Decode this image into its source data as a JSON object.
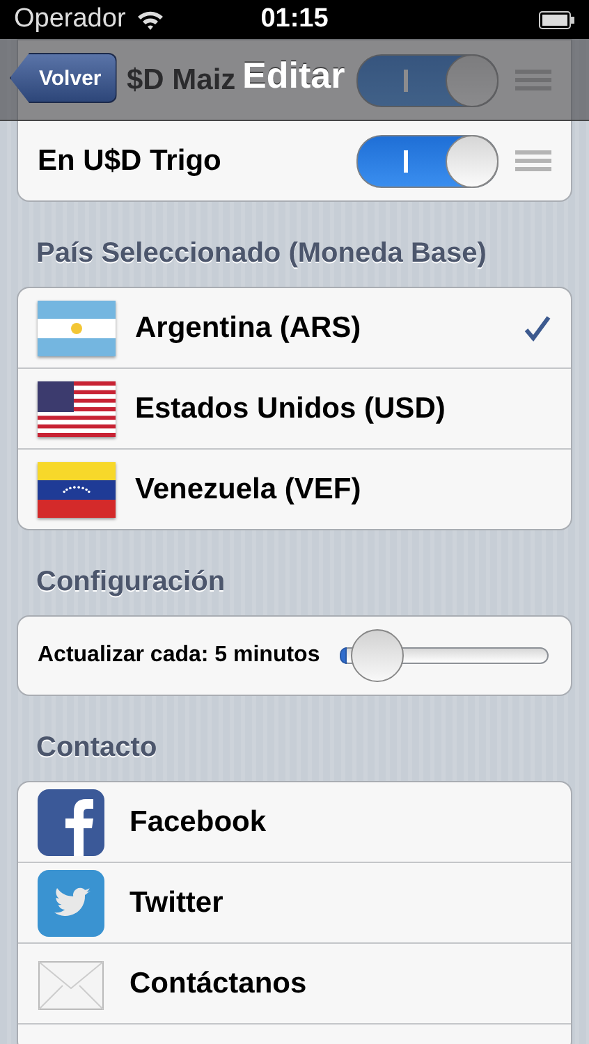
{
  "status_bar": {
    "carrier": "Operador",
    "time": "01:15"
  },
  "nav_bar": {
    "back_button": "Volver",
    "title": "Editar"
  },
  "toggles": [
    {
      "label": "$D Maiz",
      "on": true
    },
    {
      "label": "En U$D Trigo",
      "on": true
    }
  ],
  "country_section": {
    "header": "País Seleccionado (Moneda Base)",
    "items": [
      {
        "kind": "ar",
        "name": "Argentina (ARS)",
        "selected": true
      },
      {
        "kind": "us",
        "name": "Estados Unidos (USD)",
        "selected": false
      },
      {
        "kind": "ve",
        "name": "Venezuela (VEF)",
        "selected": false
      }
    ]
  },
  "config_section": {
    "header": "Configuración",
    "slider": {
      "label": "Actualizar cada: 5 minutos",
      "level": 0.02
    }
  },
  "contact_section": {
    "header": "Contacto",
    "items": [
      {
        "kind": "facebook",
        "label": "Facebook"
      },
      {
        "kind": "twitter",
        "label": "Twitter"
      },
      {
        "kind": "mail",
        "label": "Contáctanos"
      }
    ]
  }
}
